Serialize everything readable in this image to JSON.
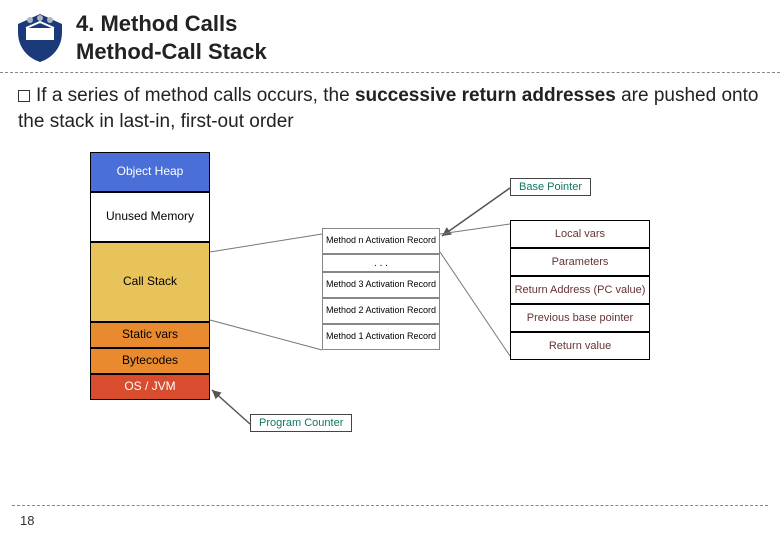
{
  "header": {
    "title_line1": "4. Method Calls",
    "title_line2": "Method-Call Stack"
  },
  "bullet": {
    "prefix": "If",
    "mid1": " a series of method calls occurs, the ",
    "strong": "successive return addresses",
    "mid2": " are pushed onto the stack in last-in, first-out order"
  },
  "stack": {
    "object_heap": "Object Heap",
    "unused": "Unused Memory",
    "call_stack": "Call Stack",
    "static_vars": "Static vars",
    "bytecodes": "Bytecodes",
    "os_jvm": "OS / JVM"
  },
  "mid": {
    "m_n": "Method n Activation Record",
    "dots": ". . .",
    "m3": "Method 3 Activation Record",
    "m2": "Method 2 Activation Record",
    "m1": "Method 1 Activation Record"
  },
  "labels": {
    "base_pointer": "Base Pointer",
    "program_counter": "Program Counter"
  },
  "record": {
    "local_vars": "Local vars",
    "parameters": "Parameters",
    "return_addr": "Return Address (PC value)",
    "prev_bp": "Previous base pointer",
    "return_val": "Return value"
  },
  "page_number": "18"
}
